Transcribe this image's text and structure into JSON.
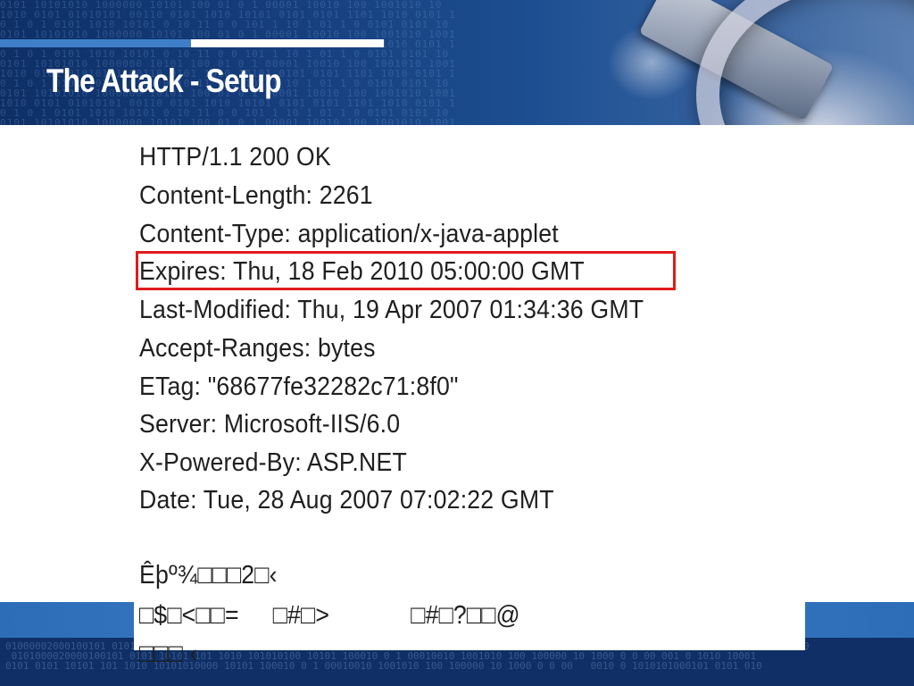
{
  "slide": {
    "title": "The Attack - Setup"
  },
  "response": {
    "lines": [
      "HTTP/1.1 200 OK",
      "Content-Length: 2261",
      "Content-Type: application/x-java-applet",
      "Expires: Thu, 18 Feb 2010 05:00:00 GMT",
      "Last-Modified: Thu, 19 Apr 2007 01:34:36 GMT",
      "Accept-Ranges: bytes",
      "ETag: \"68677fe32282c71:8f0\"",
      "Server: Microsoft-IIS/6.0",
      "X-Powered-By: ASP.NET",
      "Date: Tue, 28 Aug 2007 07:02:22 GMT"
    ],
    "highlighted_line_index": 3,
    "body_garbage": [
      "Êþº¾□□□2□‹",
      "□$□<□□=     □#□>            □#□?□□@",
      "□□□ ‹"
    ]
  },
  "colors": {
    "header_dark": "#0e2f66",
    "accent_blue": "#3f7fc7",
    "highlight_red": "#e01b1b"
  }
}
